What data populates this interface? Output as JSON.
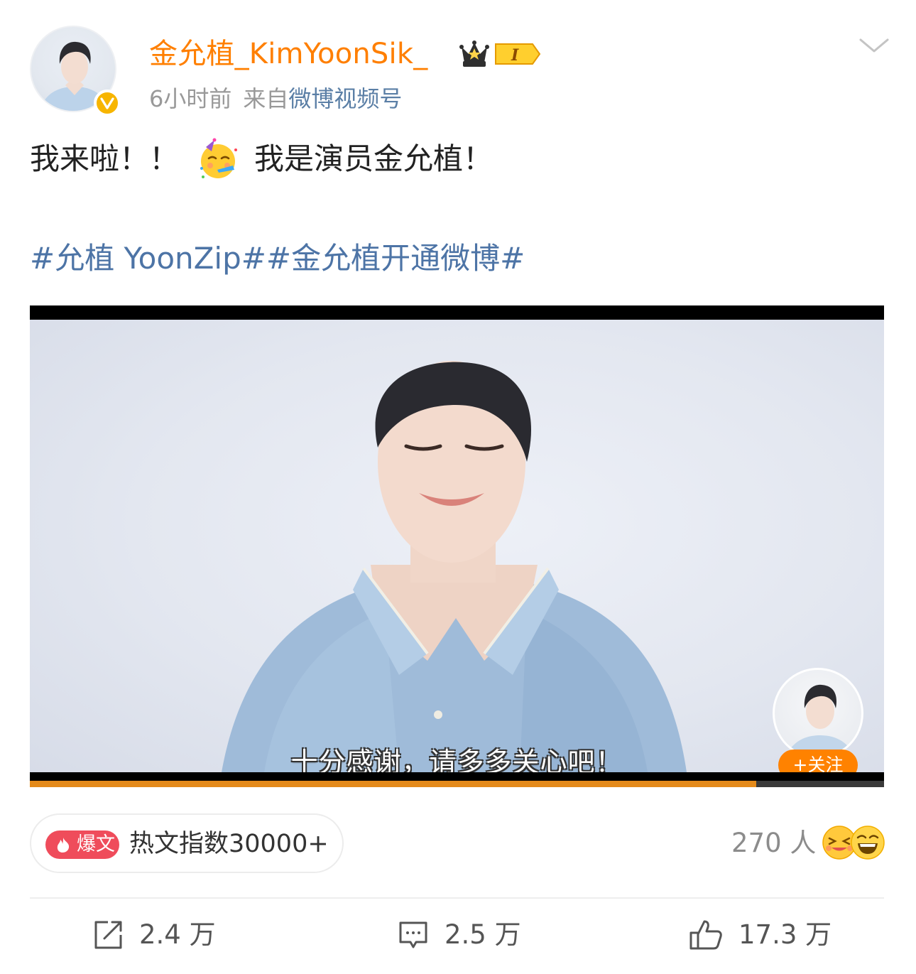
{
  "user": {
    "name": "金允植_KimYoonSik_",
    "time": "6小时前",
    "from": "来自",
    "source": "微博视频号"
  },
  "post": {
    "text_before": "我来啦！！",
    "text_after": "我是演员金允植！",
    "hashtags": "#允植 YoonZip##金允植开通微博#"
  },
  "video": {
    "subtitle": "十分感谢，请多多关心吧！",
    "follow_label": "+关注",
    "progress": 0.85
  },
  "hot": {
    "tag": "爆文",
    "text": "热文指数30000+"
  },
  "reactions": {
    "count": "270 人"
  },
  "actions": {
    "repost": "2.4 万",
    "comment": "2.5 万",
    "like": "17.3 万"
  },
  "colors": {
    "username": "#ff7f00",
    "hashtag": "#4d74a6",
    "follow": "#ff8200",
    "hot_tag": "#ef4c5b",
    "progress": "#e48a1a"
  }
}
